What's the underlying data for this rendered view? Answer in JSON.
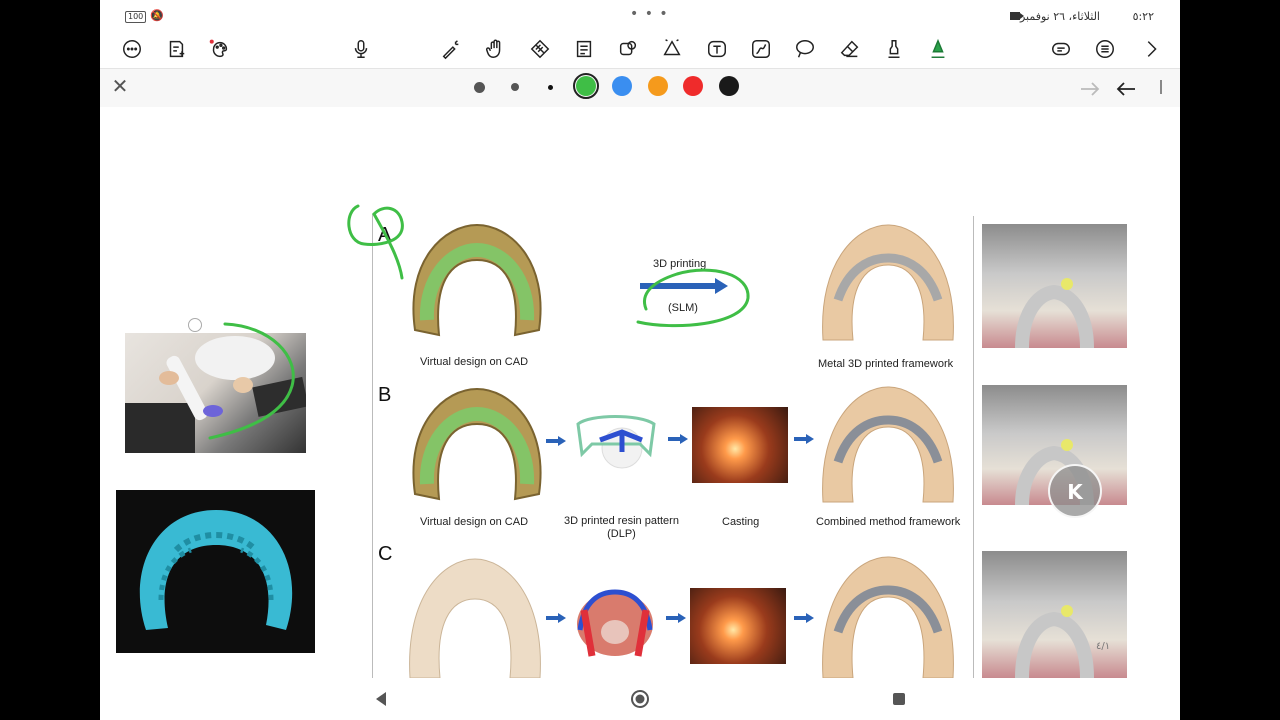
{
  "status_bar": {
    "battery": "100",
    "time": "٥:٢٢",
    "date": "الثلاثاء، ٢٦ نوفمبر"
  },
  "toolbar": {
    "left_icons": [
      "more-icon",
      "add-page-icon",
      "sticker-icon"
    ],
    "center_icons": [
      "microphone-icon",
      "laser-pointer-icon",
      "hand-icon",
      "selection-icon",
      "text-box-icon",
      "shapes-icon",
      "fill-icon",
      "insert-text-icon",
      "line-icon",
      "lasso-icon",
      "eraser-icon",
      "highlighter-icon",
      "pen-icon"
    ],
    "right_icons": [
      "layers-icon",
      "list-icon",
      "chevron-right-icon"
    ]
  },
  "pen_bar": {
    "colors": [
      "#3fbe46",
      "#3a8ef0",
      "#f59a1c",
      "#ef2b2b",
      "#1a1a1a"
    ],
    "selected_color": "#3fbe46"
  },
  "figure": {
    "row_a": {
      "letter": "A",
      "arrow_top": "3D printing",
      "arrow_bottom": "(SLM)",
      "label_cad": "Virtual design on CAD",
      "label_final": "Metal 3D printed framework"
    },
    "row_b": {
      "letter": "B",
      "label_cad": "Virtual design on CAD",
      "label_resin": "3D printed resin pattern\n(DLP)",
      "label_casting": "Casting",
      "label_final": "Combined method framework"
    },
    "row_c": {
      "letter": "C"
    }
  },
  "floating_button": {
    "label": "K"
  },
  "page_indicator": "٤/١"
}
